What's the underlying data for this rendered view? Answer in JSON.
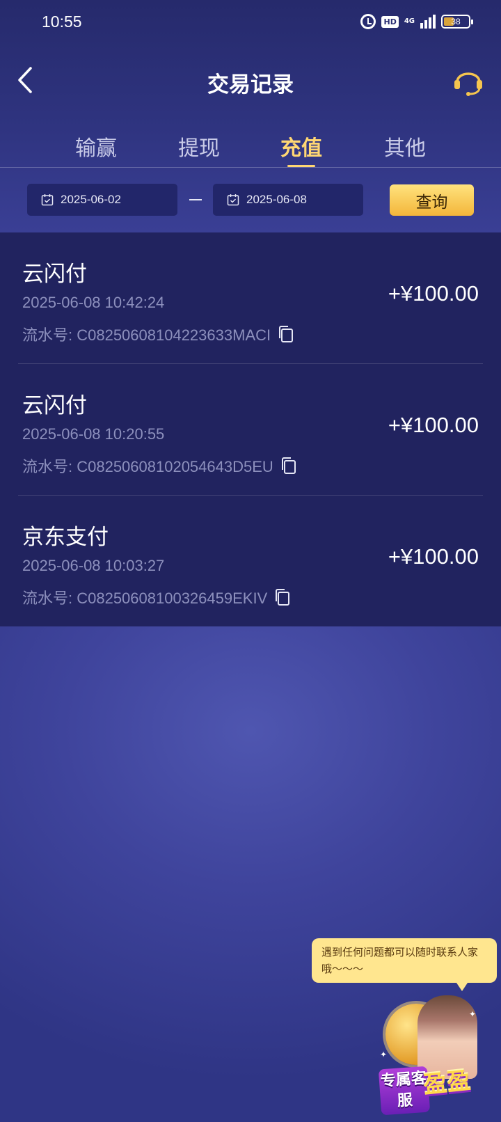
{
  "status_bar": {
    "time": "10:55",
    "hd_label": "HD",
    "network_label": "4G",
    "battery_level": "38"
  },
  "header": {
    "title": "交易记录",
    "back_icon": "chevron-left-icon",
    "support_icon": "headset-icon"
  },
  "tabs": [
    {
      "label": "输赢",
      "active": false
    },
    {
      "label": "提现",
      "active": false
    },
    {
      "label": "充值",
      "active": true
    },
    {
      "label": "其他",
      "active": false
    }
  ],
  "filter": {
    "start_date": "2025-06-02",
    "end_date": "2025-06-08",
    "query_label": "查询"
  },
  "records": [
    {
      "channel": "云闪付",
      "datetime": "2025-06-08 10:42:24",
      "serial": "流水号: C08250608104223633MACI",
      "amount": "+¥100.00"
    },
    {
      "channel": "云闪付",
      "datetime": "2025-06-08 10:20:55",
      "serial": "流水号: C08250608102054643D5EU",
      "amount": "+¥100.00"
    },
    {
      "channel": "京东支付",
      "datetime": "2025-06-08 10:03:27",
      "serial": "流水号: C08250608100326459EKIV",
      "amount": "+¥100.00"
    }
  ],
  "customer_service": {
    "bubble_text": "遇到任何问题都可以随时联系人家哦～～～",
    "badge_left": "专属客服",
    "badge_right": "盈盈"
  },
  "colors": {
    "accent": "#ffd773",
    "list_bg": "#21235f",
    "button_gradient_top": "#ffe27e",
    "button_gradient_bottom": "#f3b63a"
  }
}
